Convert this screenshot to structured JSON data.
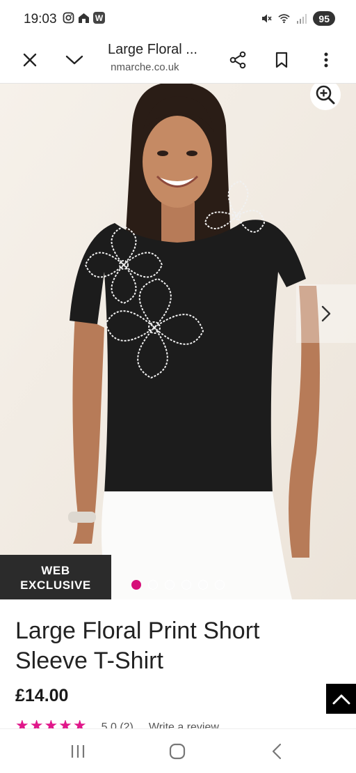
{
  "status_bar": {
    "time": "19:03",
    "battery": "95",
    "left_icons": [
      "instagram-icon",
      "home-app-icon",
      "w-app-icon"
    ],
    "w_label": "W",
    "right_icons": [
      "mute-icon",
      "wifi-icon",
      "signal-icon"
    ]
  },
  "browser": {
    "title": "Large Floral ...",
    "url": " nmarche.co.uk",
    "buttons": [
      "close-icon",
      "chevron-down-icon",
      "share-icon",
      "bookmark-icon",
      "more-vertical-icon"
    ]
  },
  "gallery": {
    "badge_line1": "WEB",
    "badge_line2": "EXCLUSIVE",
    "dot_count": 6,
    "active_index": 0,
    "accent": "#d6107a"
  },
  "product": {
    "title": "Large Floral Print Short Sleeve T-Shirt",
    "price": "£14.00",
    "rating_stars": "★★★★★",
    "rating_value": "5.0 (2)",
    "review_link": "Write a review"
  },
  "colors": {
    "accent_pink": "#d6107a",
    "badge_bg": "#2b2b2b",
    "shirt": "#1c1c1c"
  }
}
